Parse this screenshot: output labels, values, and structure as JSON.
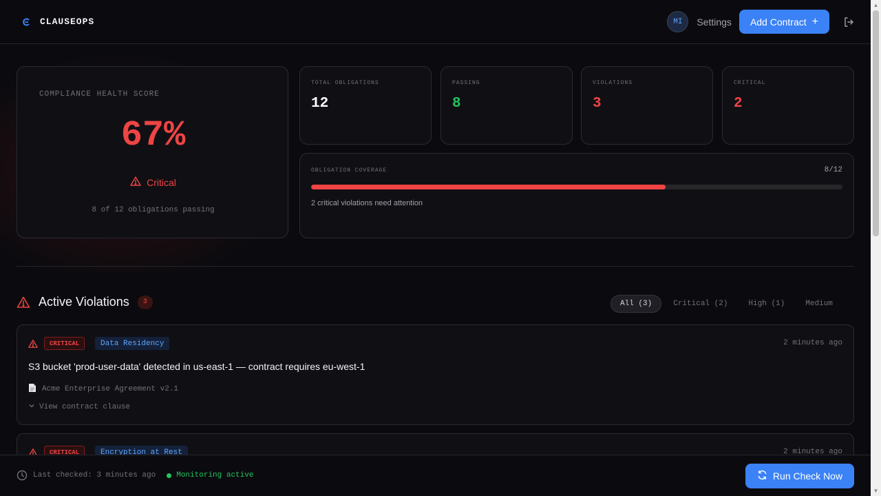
{
  "brand": {
    "name": "CLAUSEOPS",
    "logo_icon": "clauseops-logo-icon"
  },
  "header": {
    "avatar_initials": "MI",
    "settings_label": "Settings",
    "add_contract_label": "Add Contract",
    "add_icon": "+"
  },
  "score": {
    "label": "COMPLIANCE HEALTH SCORE",
    "value": "67%",
    "status": "Critical",
    "subtitle": "8 of 12 obligations passing"
  },
  "stats": [
    {
      "label": "TOTAL OBLIGATIONS",
      "value": "12",
      "color": "#ffffff"
    },
    {
      "label": "PASSING",
      "value": "8",
      "color": "#22c55e"
    },
    {
      "label": "VIOLATIONS",
      "value": "3",
      "color": "#ef4444"
    },
    {
      "label": "CRITICAL",
      "value": "2",
      "color": "#ef4444"
    }
  ],
  "coverage": {
    "label": "OBLIGATION COVERAGE",
    "count": "8/12",
    "fraction": 0.6667,
    "note": "2 critical violations need attention"
  },
  "violations_section": {
    "title": "Active Violations",
    "count": "3",
    "filters": [
      {
        "label": "All (3)",
        "active": true
      },
      {
        "label": "Critical (2)",
        "active": false
      },
      {
        "label": "High (1)",
        "active": false
      },
      {
        "label": "Medium",
        "active": false
      }
    ]
  },
  "violations": [
    {
      "severity": "CRITICAL",
      "category": "Data Residency",
      "time": "2 minutes ago",
      "message": "S3 bucket 'prod-user-data' detected in us-east-1 — contract requires eu-west-1",
      "document": "Acme Enterprise Agreement v2.1",
      "clause_toggle": "View contract clause"
    },
    {
      "severity": "CRITICAL",
      "category": "Encryption at Rest",
      "time": "2 minutes ago"
    }
  ],
  "footer": {
    "last_checked": "Last checked: 3 minutes ago",
    "monitoring": "Monitoring active",
    "run_check_label": "Run Check Now"
  },
  "colors": {
    "accent": "#3b82f6",
    "danger": "#ef4444",
    "success": "#22c55e",
    "background": "#0b0b0f"
  }
}
